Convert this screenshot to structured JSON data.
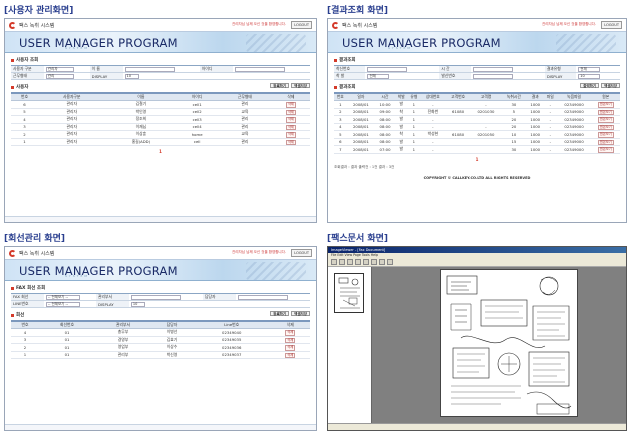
{
  "titles": {
    "q1": "[사용자 관리화면]",
    "q2": "[결과조회 화면]",
    "q3": "[회선관리 화면]",
    "q4": "[팩스문서 화면]"
  },
  "app": {
    "name": "팩스 녹취 시스템",
    "banner": "USER MANAGER PROGRAM",
    "banner_sub": "SYSTEM",
    "top_note": "관리자님 님께 오신 것을 환영합니다.",
    "logout": "LOGOUT"
  },
  "user_screen": {
    "section": "사용자 조회",
    "filters": [
      {
        "label": "사용자 구분",
        "value": "관리자"
      },
      {
        "label": "이 름",
        "value": ""
      },
      {
        "label": "아이디",
        "value": ""
      },
      {
        "label": "근무형태",
        "value": "관리"
      },
      {
        "label": "DISPLAY",
        "value": "10"
      }
    ],
    "list_title": "사용자",
    "buttons": [
      "등록하기",
      "엑셀저장"
    ],
    "columns": [
      "번호",
      "사용자구분",
      "이름",
      "아이디",
      "근무형태",
      "삭제"
    ],
    "rows": [
      [
        "6",
        "관리자",
        "김철기",
        "cell1",
        "관리",
        "삭제"
      ],
      [
        "5",
        "관리자",
        "박인영",
        "cell2",
        "교육",
        "삭제"
      ],
      [
        "4",
        "관리자",
        "정조희",
        "cell3",
        "관리",
        "삭제"
      ],
      [
        "3",
        "관리자",
        "이재님",
        "cell4",
        "관리",
        "삭제"
      ],
      [
        "2",
        "관리자",
        "이상훈",
        "home",
        "교육",
        "삭제"
      ],
      [
        "1",
        "관리자",
        "홍길(ADD)",
        "cell",
        "관리",
        "삭제"
      ]
    ],
    "page": "1"
  },
  "result_screen": {
    "section": "결과조회",
    "filters": [
      {
        "label": "착신번호",
        "value": ""
      },
      {
        "label": "시 간",
        "value": ""
      },
      {
        "label": "결과유형",
        "value": "전체"
      },
      {
        "label": "착 발",
        "value": "전체"
      },
      {
        "label": "발신번호",
        "value": ""
      },
      {
        "label": "DISPLAY",
        "value": "10"
      }
    ],
    "list_title": "결과조회",
    "buttons": [
      "출력하기",
      "엑셀저장"
    ],
    "columns": [
      "번호",
      "일자",
      "시간",
      "착발",
      "유형",
      "상대번호",
      "고객번호",
      "고객명",
      "녹취시간",
      "결과",
      "파일",
      "녹음파일",
      "원본"
    ],
    "rows": [
      [
        "1",
        "2008/01",
        "10:00",
        "발",
        "1",
        "-",
        "",
        "-",
        "30",
        "1000",
        "-",
        "02349000",
        "원본보기"
      ],
      [
        "2",
        "2008/01",
        "09:00",
        "착",
        "1",
        "전화번",
        "61080",
        "0201030",
        "5",
        "1000",
        "-",
        "02349000",
        "원본보기"
      ],
      [
        "3",
        "2008/01",
        "08:00",
        "발",
        "1",
        "-",
        "",
        "",
        "20",
        "1000",
        "-",
        "02349000",
        "원본보기"
      ],
      [
        "4",
        "2008/01",
        "08:00",
        "발",
        "1",
        "-",
        "",
        "-",
        "20",
        "1000",
        "-",
        "02349000",
        "원본보기"
      ],
      [
        "5",
        "2008/01",
        "08:00",
        "착",
        "1",
        "박성현",
        "61080",
        "0201050",
        "10",
        "1000",
        "-",
        "02349000",
        "원본보기"
      ],
      [
        "6",
        "2008/01",
        "08:00",
        "발",
        "1",
        "-",
        "",
        "",
        "15",
        "1000",
        "-",
        "02349000",
        "원본보기"
      ],
      [
        "7",
        "2008/01",
        "07:00",
        "발",
        "1",
        "-",
        "",
        "",
        "30",
        "1000",
        "-",
        "02349000",
        "원본보기"
      ]
    ],
    "info": "조회결과 : 결과 출력건 : 1건 결과 : 3건",
    "copyright": "COPYRIGHT © CALLKEY.CO.LTD ALL RIGHTS RESERVED",
    "page": "1"
  },
  "line_screen": {
    "section": "FAX 회선 조회",
    "filters": [
      {
        "label": "FAX 회선",
        "value": "-- 전체보기 --"
      },
      {
        "label": "관리부서",
        "value": ""
      },
      {
        "label": "담당자",
        "value": ""
      },
      {
        "label": "LINE번호",
        "value": "-- 전체보기 --"
      },
      {
        "label": "DISPLAY",
        "value": "10"
      }
    ],
    "list_title": "회선",
    "buttons": [
      "등록하기",
      "엑셀저장"
    ],
    "columns": [
      "번호",
      "회선번호",
      "관리부서",
      "담당자",
      "Line번호",
      "삭제"
    ],
    "rows": [
      [
        "4",
        "01",
        "총무부",
        "이병선",
        "02349040",
        "삭제"
      ],
      [
        "3",
        "01",
        "경영부",
        "김효기",
        "02349035",
        "삭제"
      ],
      [
        "2",
        "01",
        "영업부",
        "이상수",
        "02349036",
        "삭제"
      ],
      [
        "1",
        "01",
        "관리부",
        "박신영",
        "02349037",
        "삭제"
      ]
    ]
  },
  "fax_viewer": {
    "window_title": "ImageViewer - [Fax Document]",
    "menu": "File  Edit  View  Page  Tools  Help"
  }
}
